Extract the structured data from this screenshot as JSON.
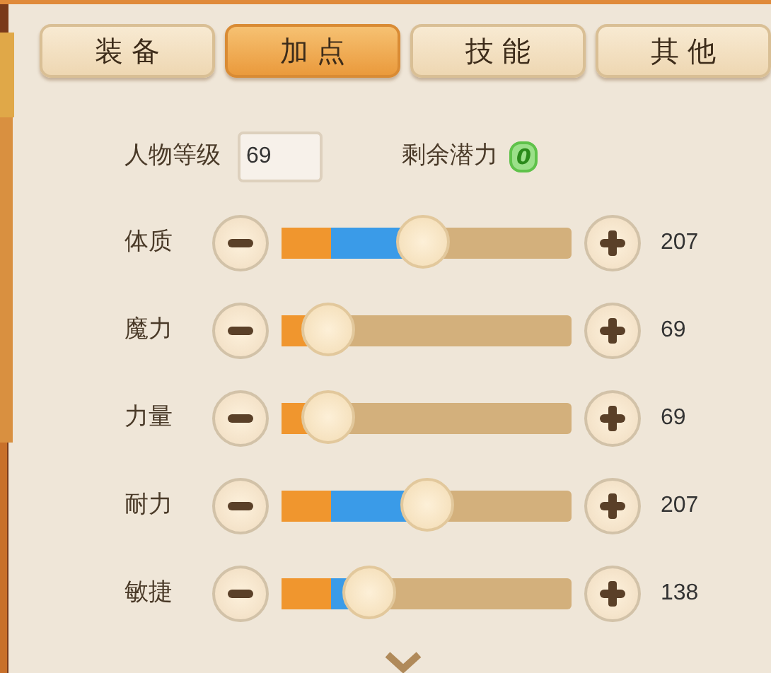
{
  "tabs": [
    {
      "label": "装 备",
      "selected": false
    },
    {
      "label": "加 点",
      "selected": true
    },
    {
      "label": "技 能",
      "selected": false
    },
    {
      "label": "其 他",
      "selected": false
    }
  ],
  "level": {
    "label": "人物等级",
    "value": "69"
  },
  "potential": {
    "label": "剩余潜力",
    "value": "0"
  },
  "attributes": [
    {
      "name": "体质",
      "value": "207",
      "fill": [
        {
          "kind": "base",
          "level": 0.17
        },
        {
          "kind": "added",
          "level": 0.32
        }
      ]
    },
    {
      "name": "魔力",
      "value": "69",
      "fill": [
        {
          "kind": "base",
          "level": 0.16
        }
      ]
    },
    {
      "name": "力量",
      "value": "69",
      "fill": [
        {
          "kind": "base",
          "level": 0.16
        }
      ]
    },
    {
      "name": "耐力",
      "value": "207",
      "fill": [
        {
          "kind": "base",
          "level": 0.17
        },
        {
          "kind": "added",
          "level": 0.33
        }
      ]
    },
    {
      "name": "敏捷",
      "value": "138",
      "fill": [
        {
          "kind": "base",
          "level": 0.17
        },
        {
          "kind": "added",
          "level": 0.13
        }
      ]
    }
  ]
}
